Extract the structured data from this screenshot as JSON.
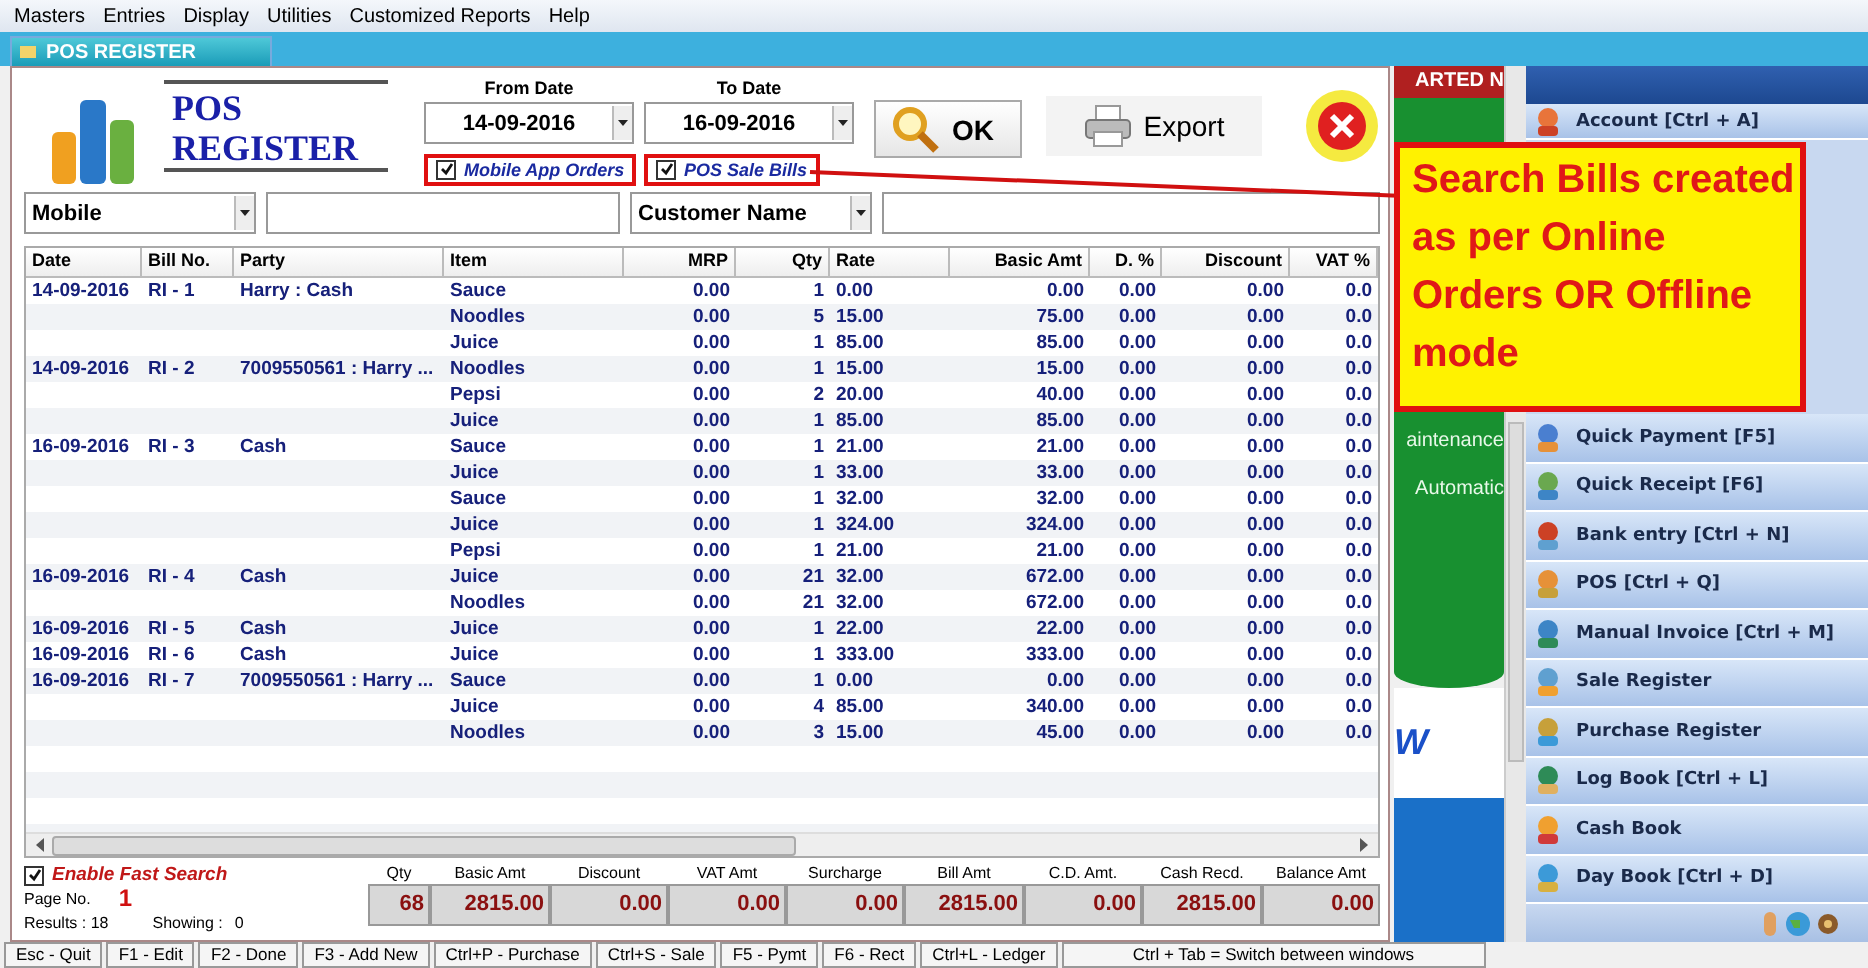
{
  "menu": [
    "Masters",
    "Entries",
    "Display",
    "Utilities",
    "Customized Reports",
    "Help"
  ],
  "window": {
    "title": "POS REGISTER"
  },
  "header": {
    "title_lines": [
      "POS",
      "REGISTER"
    ],
    "dates": [
      {
        "label": "From Date",
        "value": "14-09-2016"
      },
      {
        "label": "To Date",
        "value": "16-09-2016"
      }
    ],
    "filters": [
      {
        "label": "Mobile App Orders",
        "checked": true
      },
      {
        "label": "POS Sale Bills",
        "checked": true
      }
    ],
    "buttons": [
      {
        "kind": "ok",
        "label": "OK"
      },
      {
        "kind": "export",
        "label": "Export"
      },
      {
        "kind": "close"
      }
    ]
  },
  "search": [
    {
      "kind": "select",
      "value": "Mobile"
    },
    {
      "kind": "input"
    },
    {
      "kind": "select",
      "value": "Customer Name"
    },
    {
      "kind": "input"
    }
  ],
  "table": {
    "columns": [
      "Date",
      "Bill No.",
      "Party",
      "Item",
      "MRP",
      "Qty",
      "Rate",
      "Basic Amt",
      "D. %",
      "Discount",
      "VAT %"
    ],
    "rows": [
      [
        "14-09-2016",
        "RI - 1",
        "Harry : Cash",
        "Sauce",
        "0.00",
        "1",
        "0.00",
        "0.00",
        "0.00",
        "0.00",
        "0.0"
      ],
      [
        null,
        null,
        null,
        "Noodles",
        "0.00",
        "5",
        "15.00",
        "75.00",
        "0.00",
        "0.00",
        "0.0"
      ],
      [
        null,
        null,
        null,
        "Juice",
        "0.00",
        "1",
        "85.00",
        "85.00",
        "0.00",
        "0.00",
        "0.0"
      ],
      [
        "14-09-2016",
        "RI - 2",
        "7009550561 : Harry ...",
        "Noodles",
        "0.00",
        "1",
        "15.00",
        "15.00",
        "0.00",
        "0.00",
        "0.0"
      ],
      [
        null,
        null,
        null,
        "Pepsi",
        "0.00",
        "2",
        "20.00",
        "40.00",
        "0.00",
        "0.00",
        "0.0"
      ],
      [
        null,
        null,
        null,
        "Juice",
        "0.00",
        "1",
        "85.00",
        "85.00",
        "0.00",
        "0.00",
        "0.0"
      ],
      [
        "16-09-2016",
        "RI - 3",
        "Cash",
        "Sauce",
        "0.00",
        "1",
        "21.00",
        "21.00",
        "0.00",
        "0.00",
        "0.0"
      ],
      [
        null,
        null,
        null,
        "Juice",
        "0.00",
        "1",
        "33.00",
        "33.00",
        "0.00",
        "0.00",
        "0.0"
      ],
      [
        null,
        null,
        null,
        "Sauce",
        "0.00",
        "1",
        "32.00",
        "32.00",
        "0.00",
        "0.00",
        "0.0"
      ],
      [
        null,
        null,
        null,
        "Juice",
        "0.00",
        "1",
        "324.00",
        "324.00",
        "0.00",
        "0.00",
        "0.0"
      ],
      [
        null,
        null,
        null,
        "Pepsi",
        "0.00",
        "1",
        "21.00",
        "21.00",
        "0.00",
        "0.00",
        "0.0"
      ],
      [
        "16-09-2016",
        "RI - 4",
        "Cash",
        "Juice",
        "0.00",
        "21",
        "32.00",
        "672.00",
        "0.00",
        "0.00",
        "0.0"
      ],
      [
        null,
        null,
        null,
        "Noodles",
        "0.00",
        "21",
        "32.00",
        "672.00",
        "0.00",
        "0.00",
        "0.0"
      ],
      [
        "16-09-2016",
        "RI - 5",
        "Cash",
        "Juice",
        "0.00",
        "1",
        "22.00",
        "22.00",
        "0.00",
        "0.00",
        "0.0"
      ],
      [
        "16-09-2016",
        "RI - 6",
        "Cash",
        "Juice",
        "0.00",
        "1",
        "333.00",
        "333.00",
        "0.00",
        "0.00",
        "0.0"
      ],
      [
        "16-09-2016",
        "RI - 7",
        "7009550561 : Harry ...",
        "Sauce",
        "0.00",
        "1",
        "0.00",
        "0.00",
        "0.00",
        "0.00",
        "0.0"
      ],
      [
        null,
        null,
        null,
        "Juice",
        "0.00",
        "4",
        "85.00",
        "340.00",
        "0.00",
        "0.00",
        "0.0"
      ],
      [
        null,
        null,
        null,
        "Noodles",
        "0.00",
        "3",
        "15.00",
        "45.00",
        "0.00",
        "0.00",
        "0.0"
      ]
    ]
  },
  "fast_search": {
    "label": "Enable Fast Search",
    "checked": true
  },
  "paging": {
    "page_label": "Page No.",
    "page": "1",
    "results": "Results : 18",
    "showing_label": "Showing :",
    "showing": "0"
  },
  "totals": [
    {
      "label": "Qty",
      "value": "68"
    },
    {
      "label": "Basic Amt",
      "value": "2815.00"
    },
    {
      "label": "Discount",
      "value": "0.00"
    },
    {
      "label": "VAT Amt",
      "value": "0.00"
    },
    {
      "label": "Surcharge",
      "value": "0.00"
    },
    {
      "label": "Bill Amt",
      "value": "2815.00"
    },
    {
      "label": "C.D. Amt.",
      "value": "0.00"
    },
    {
      "label": "Cash Recd.",
      "value": "2815.00"
    },
    {
      "label": "Balance Amt",
      "value": "0.00"
    }
  ],
  "news": {
    "header": "ARTED N",
    "lines": [
      "aintenance",
      "Automatic"
    ],
    "footer": "W"
  },
  "shortcuts": [
    "Account [Ctrl + A]",
    "Quick Payment [F5]",
    "Quick Receipt [F6]",
    "Bank entry [Ctrl + N]",
    "POS [Ctrl + Q]",
    "Manual Invoice [Ctrl + M]",
    "Sale Register",
    "Purchase Register",
    "Log Book [Ctrl + L]",
    "Cash Book",
    "Day Book [Ctrl + D]"
  ],
  "status_bar": [
    "Esc - Quit",
    "F1 - Edit",
    "F2 - Done",
    "F3 - Add New",
    "Ctrl+P - Purchase",
    "Ctrl+S - Sale",
    "F5 - Pymt",
    "F6 - Rect",
    "Ctrl+L - Ledger",
    "Ctrl + Tab = Switch between windows"
  ],
  "callout": "Search Bills created as per Online Orders OR Offline mode"
}
